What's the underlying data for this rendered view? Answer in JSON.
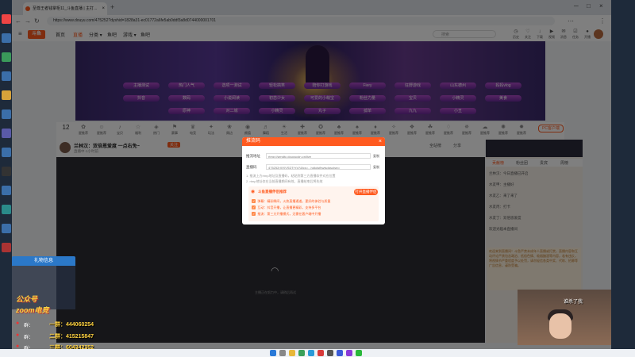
{
  "browser": {
    "tab_title": "至尊王者钱掌柜11_斗鱼直播 | 主打...",
    "url": "https://www.douyu.com/475252?dyshid=1828a31-ec01772a6fe5ab0ddf3a8d0744000001701"
  },
  "header": {
    "logo": "斗鱼",
    "nav": [
      "首页",
      "直播",
      "分类 ▾",
      "鱼吧",
      "游戏 ▾",
      "鱼吧"
    ],
    "search_placeholder": "搜索",
    "icons": [
      {
        "icon": "history-icon",
        "label": "历史"
      },
      {
        "icon": "follow-icon",
        "label": "关注"
      },
      {
        "icon": "download-icon",
        "label": "下载"
      },
      {
        "icon": "video-icon",
        "label": "视频"
      },
      {
        "icon": "message-icon",
        "label": "消息"
      },
      {
        "icon": "task-icon",
        "label": "任务"
      },
      {
        "icon": "live-icon",
        "label": "开播"
      }
    ]
  },
  "banner": {
    "row1": [
      "主播测试",
      "热门人气",
      "选项一测试",
      "轻松搞笑",
      "陪你打游戏",
      "Fiery",
      "狂野游戏",
      "山东德州",
      "妈妈vlog"
    ],
    "row2": [
      "抖音",
      "数码",
      "小说阅读",
      "初恋少女",
      "可爱的小萌宝",
      "粉丝力量",
      "宝贝",
      "小精灵",
      "美食"
    ],
    "row3": [
      "原神",
      "对二城",
      "小精灵",
      "丸子",
      "孤单",
      "九九",
      "小丑"
    ]
  },
  "catbar": {
    "count": "12",
    "items": [
      "星推荐",
      "星推荐",
      "宝贝",
      "福利",
      "热门",
      "赛事",
      "电竞",
      "玩法",
      "周边",
      "颜值",
      "舞蹈",
      "生活",
      "星推荐",
      "星推荐",
      "星推荐",
      "星推荐",
      "星推荐",
      "星推荐",
      "星推荐",
      "星推荐",
      "星推荐",
      "星推荐",
      "星推荐",
      "星推荐",
      "星推荐"
    ],
    "pc_button": "PC客户端"
  },
  "room": {
    "title": "兰林汉：双倍恩爱度 一点右免~",
    "follow": "关注",
    "meta": "直播中·1小时前",
    "gift_tab": "全站榜",
    "share": "分享"
  },
  "modal": {
    "title": "推流码",
    "addr_label": "推流地址",
    "addr_value": "rtmp://sendtc.douyucdn.cn/live",
    "code_label": "直播码",
    "code_value": "475252rXfXVSDTrYg?&fcs=...hdkdsfbwtsdgsolseo",
    "copy": "复制",
    "tip1": "1. 推流上方rtmp地址及直播码，粘贴到第三方直播软件对应位置",
    "tip2": "2. rtmp地址仅在当前直播期间有效，直播结束后将失效",
    "help_title": "斗鱼直播伴侣推荐",
    "open_button": "打开直播伴侣",
    "lines": [
      "弹幕：精彩瞬间，火热直播通道，更好的体验与质量",
      "互动：抖音开播，让直播更精彩，支持多平台",
      "推流：第三方开播模式，无需在客户端中开播"
    ]
  },
  "right": {
    "tabs": [
      "贡献榜",
      "粉丝团",
      "贵宾",
      "周榜"
    ],
    "chat": [
      "兰林汉：今日直播已开启",
      "水友甲：主播好",
      "水友乙：来了来了",
      "水友丙：打卡",
      "水友丁：双倍恩爱度",
      "欢迎光临本直播间"
    ],
    "notice": "欢迎来到直播间！斗鱼严禁未成年人直播或打赏，直播内容和互动评论严禁包含政治、低俗色情、吸烟酗酒等内容，若有违反，将视情节严重程度予以处罚，请勿轻信各类中奖、代练、招募等广告信息，谨防受骗。"
  },
  "video": {
    "loading": "主播正在努力中，请稍后再试"
  },
  "gift": {
    "title": "礼物信息",
    "promo1": "公众号",
    "promo2": "zoom电竞",
    "groups": [
      {
        "label": "群：",
        "num": "一群：444060254"
      },
      {
        "label": "群：",
        "num": "二群：415215847"
      },
      {
        "label": "群：",
        "num": "三群：604342352"
      }
    ]
  },
  "webcam": {
    "caption": "谁杀了我"
  }
}
